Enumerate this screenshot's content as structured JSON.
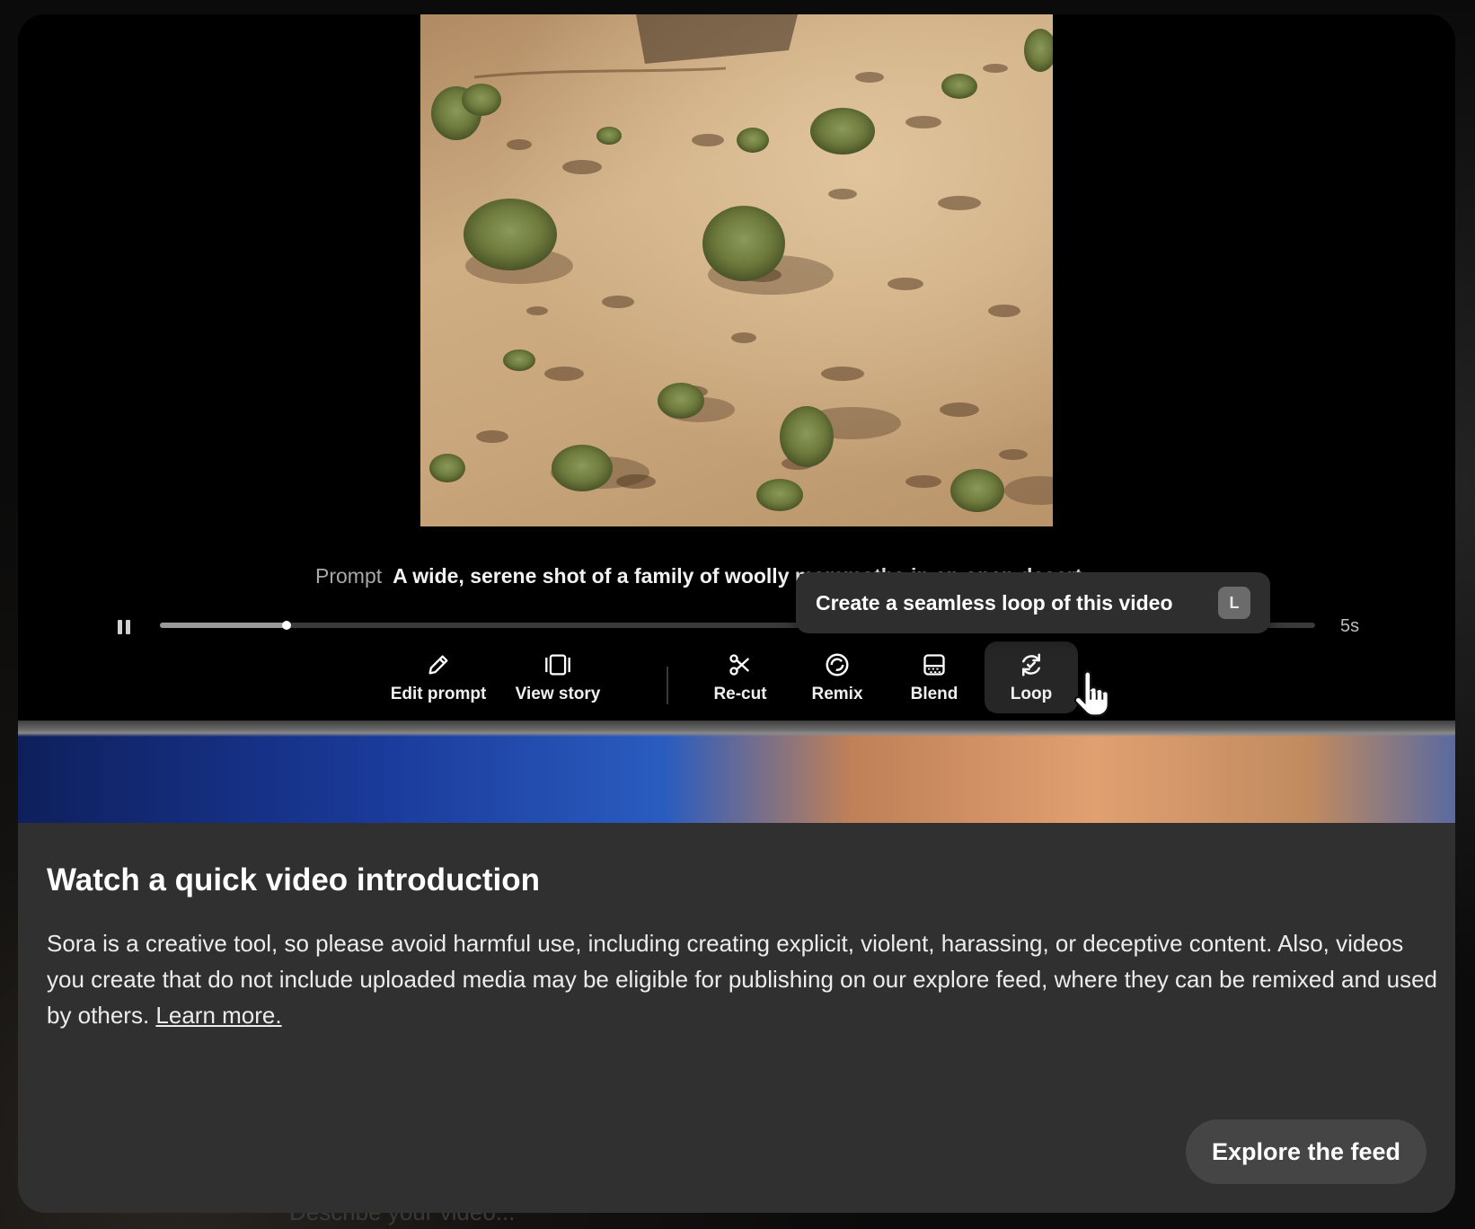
{
  "backdrop": {
    "prompt_placeholder": "Describe your video..."
  },
  "video": {
    "prompt_label": "Prompt",
    "prompt_text": "A wide, serene shot of a family of woolly mammoths in an open desert",
    "progress": 0.11,
    "duration": "5s"
  },
  "tooltip": {
    "text": "Create a seamless loop of this video",
    "shortcut": "L"
  },
  "toolbar": {
    "edit_prompt": "Edit prompt",
    "view_story": "View story",
    "recut": "Re-cut",
    "remix": "Remix",
    "blend": "Blend",
    "loop": "Loop"
  },
  "intro": {
    "title": "Watch a quick video introduction",
    "body": "Sora is a creative tool, so please avoid harmful use, including creating explicit, violent, harassing, or deceptive content. Also, videos you create that do not include uploaded media may be eligible for publishing on our explore feed, where they can be remixed and used by others.",
    "learn_more": "Learn more.",
    "explore_button": "Explore the feed"
  }
}
